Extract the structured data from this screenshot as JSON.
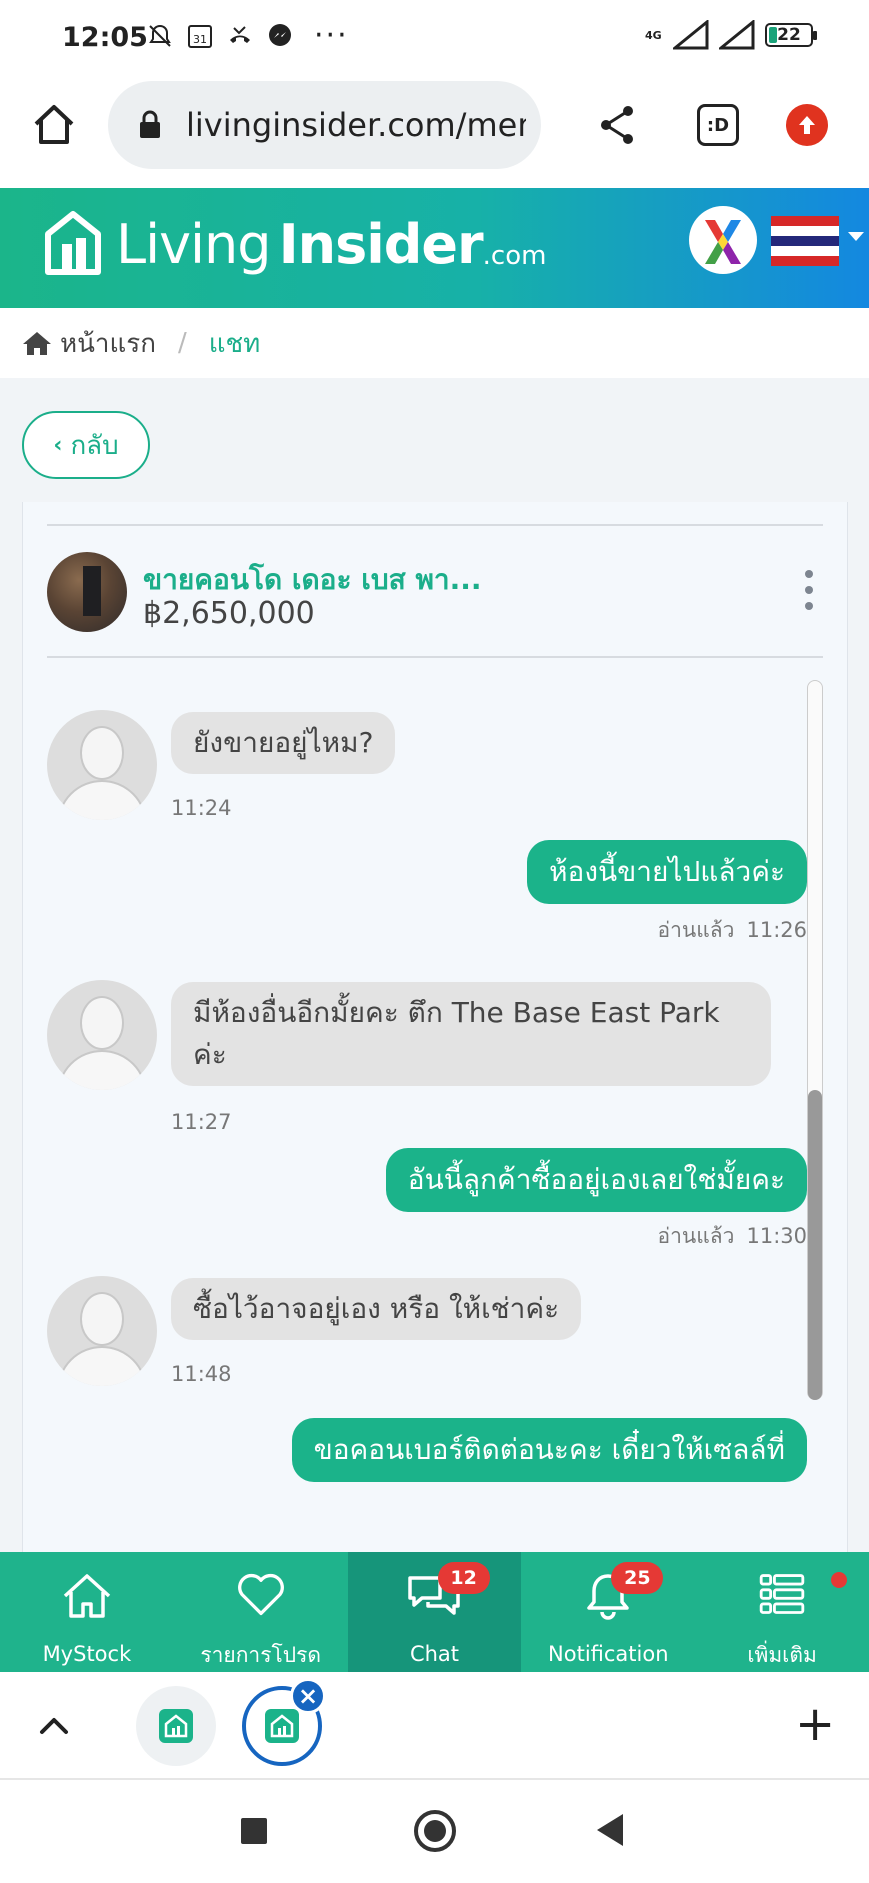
{
  "status_bar": {
    "time": "12:05",
    "network": "4G",
    "battery": "22",
    "more": "···"
  },
  "browser": {
    "url": "livinginsider.com/mem",
    "tabs_label": ":D"
  },
  "site": {
    "logo_word1": "Living",
    "logo_word2": "Insider",
    "logo_domain": ".com",
    "brand_color": "#1bb38a"
  },
  "breadcrumb": {
    "home": "หน้าแรก",
    "separator": "/",
    "current": "แชท"
  },
  "back_button": {
    "label": "กลับ",
    "chevron": "‹"
  },
  "listing": {
    "title": "ขายคอนโด เดอะ เบส พา...",
    "price": "฿2,650,000"
  },
  "messages": [
    {
      "direction": "in",
      "text": "ยังขายอยู่ไหม?",
      "time": "11:24"
    },
    {
      "direction": "out",
      "text": "ห้องนี้ขายไปแล้วค่ะ",
      "read": "อ่านแล้ว",
      "time": "11:26"
    },
    {
      "direction": "in",
      "text_line1": "มีห้องอื่นอีกมั้ยคะ ตึก The Base East Park",
      "text_line2": "ค่ะ",
      "time": "11:27"
    },
    {
      "direction": "out",
      "text": "อันนี้ลูกค้าซื้ออยู่เองเลยใช่มั้ยคะ",
      "read": "อ่านแล้ว",
      "time": "11:30"
    },
    {
      "direction": "in",
      "text": "ซื้อไว้อาจอยู่เอง หรือ ให้เช่าค่ะ",
      "time": "11:48"
    },
    {
      "direction": "out",
      "text": "ขอคอนเบอร์ติดต่อนะคะ เดี๋ยวให้เซลล์ที่"
    }
  ],
  "bottom_nav": [
    {
      "label": "MyStock",
      "icon": "home-icon"
    },
    {
      "label": "รายการโปรด",
      "icon": "heart-icon"
    },
    {
      "label": "Chat",
      "icon": "chat-icon",
      "badge": "12",
      "active": true
    },
    {
      "label": "Notification",
      "icon": "bell-icon",
      "badge": "25"
    },
    {
      "label": "เพิ่มเติม",
      "icon": "menu-list-icon",
      "dot": true
    }
  ],
  "tabstrip": {
    "close": "×",
    "plus": "+"
  }
}
